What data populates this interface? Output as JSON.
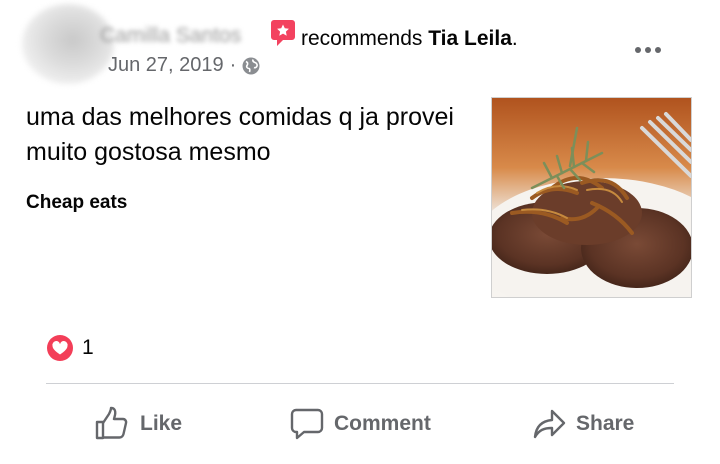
{
  "post": {
    "author_name": "Camilla Santos",
    "recommends_text": "recommends",
    "page_name": "Tia Leila",
    "trailing_period": ".",
    "date": "Jun 27, 2019",
    "separator": "·",
    "body_text": "uma das melhores comidas q ja provei muito gostosa mesmo",
    "tag": "Cheap eats"
  },
  "reactions": {
    "count": "1",
    "type": "heart-icon"
  },
  "actions": {
    "like_label": "Like",
    "comment_label": "Comment",
    "share_label": "Share"
  },
  "colors": {
    "badge_red": "#f3425f",
    "heart_red": "#f33e58",
    "secondary_text": "#65676b",
    "divider": "#ced0d4"
  }
}
